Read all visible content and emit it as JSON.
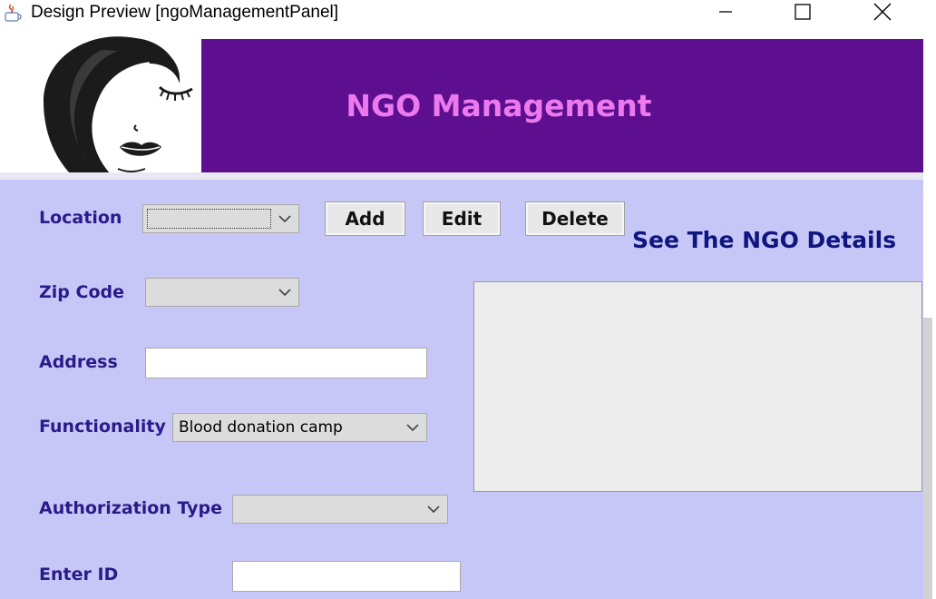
{
  "window": {
    "title": "Design Preview [ngoManagementPanel]",
    "controls": [
      "minimize-icon",
      "maximize-icon",
      "close-icon"
    ]
  },
  "header": {
    "title": "NGO Management",
    "banner_color": "#5d0f8f",
    "title_color": "#ec7aee",
    "logo_icon": "woman-face-logo"
  },
  "form": {
    "location": {
      "label": "Location",
      "value": ""
    },
    "zip_code": {
      "label": "Zip Code",
      "value": ""
    },
    "address": {
      "label": "Address",
      "value": ""
    },
    "functionality": {
      "label": "Functionality",
      "value": "Blood donation camp"
    },
    "authorization_type": {
      "label": "Authorization Type",
      "value": ""
    },
    "enter_id": {
      "label": "Enter ID",
      "value": ""
    }
  },
  "buttons": {
    "add": "Add",
    "edit": "Edit",
    "delete": "Delete"
  },
  "details": {
    "title": "See The NGO Details"
  },
  "colors": {
    "panel_bg": "#c7c7f7",
    "label_color": "#2a1a8a",
    "details_title_color": "#0e1680"
  }
}
